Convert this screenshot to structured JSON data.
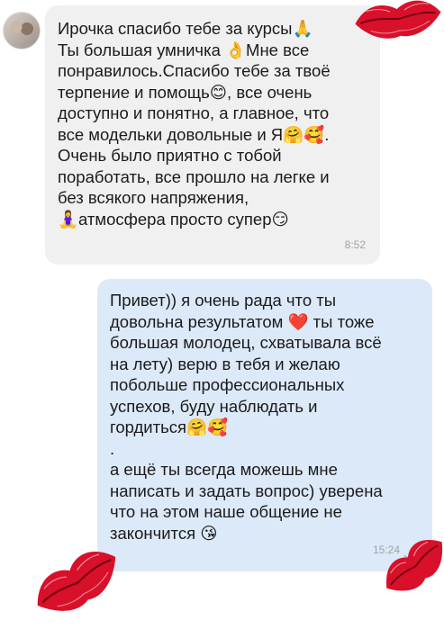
{
  "chat": {
    "incoming": {
      "lines": [
        "Ирочка спасибо тебе за курсы🙏",
        "Ты большая умничка 👌Мне все",
        "понравилось.Спасибо тебе за твоё",
        "терпение и помощь😊, все очень",
        "доступно и понятно, а главное, что",
        "все модельки довольные и Я🤗🥰.",
        "Очень было приятно с тобой",
        "поработать, все прошло на легке и",
        "без всякого напряжения,",
        "🧘‍♀️атмосфера просто супер😏"
      ],
      "time": "8:52"
    },
    "outgoing": {
      "lines": [
        "Привет)) я очень рада что ты",
        "довольна результатом ❤️ ты тоже",
        "большая молодец, схватывала всё",
        "на лету) верю в тебя и желаю",
        "побольше профессиональных",
        "успехов, буду наблюдать и",
        "гордиться🤗🥰",
        ".",
        "а ещё ты всегда можешь мне",
        "написать и задать вопрос) уверена",
        "что на этом наше общение не",
        "закончится 😘"
      ],
      "time": "15:24"
    }
  },
  "colors": {
    "incoming_bubble": "#f0f0f0",
    "outgoing_bubble": "#dce9f8",
    "lips": "#d8102a"
  },
  "icons": [
    "avatar",
    "double-check-icon",
    "lips-kiss-sticker"
  ]
}
